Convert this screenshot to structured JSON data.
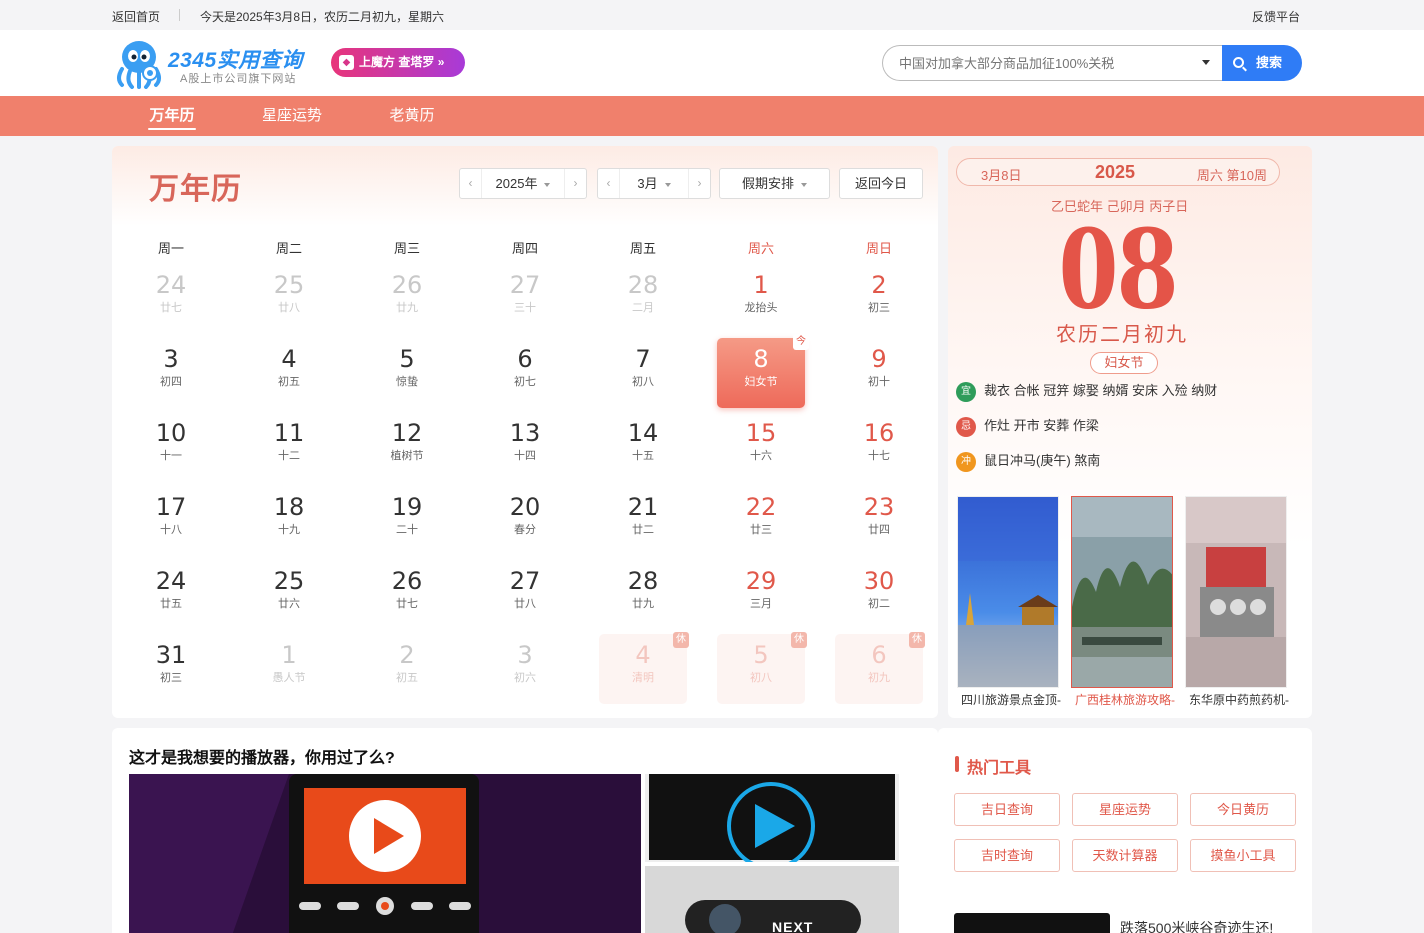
{
  "topbar": {
    "back_home": "返回首页",
    "today_text": "今天是2025年3月8日，农历二月初九，星期六",
    "feedback": "反馈平台"
  },
  "header": {
    "logo_text": "2345实用查询",
    "logo_sub": "A股上市公司旗下网站",
    "promo": "上魔方 查塔罗",
    "search_placeholder": "中国对加拿大部分商品加征100%关税",
    "search_button": "搜索"
  },
  "nav": [
    {
      "label": "万年历",
      "active": true
    },
    {
      "label": "星座运势",
      "active": false
    },
    {
      "label": "老黄历",
      "active": false
    }
  ],
  "calendar": {
    "title": "万年历",
    "year_select": "2025年",
    "month_select": "3月",
    "holiday_select": "假期安排",
    "back_today": "返回今日",
    "weekdays": [
      "周一",
      "周二",
      "周三",
      "周四",
      "周五",
      "周六",
      "周日"
    ],
    "today_badge": "今",
    "rest_badge": "休",
    "days": [
      {
        "d": "24",
        "l": "廿七",
        "s": "dim"
      },
      {
        "d": "25",
        "l": "廿八",
        "s": "dim"
      },
      {
        "d": "26",
        "l": "廿九",
        "s": "dim"
      },
      {
        "d": "27",
        "l": "三十",
        "s": "dim"
      },
      {
        "d": "28",
        "l": "二月",
        "s": "dim"
      },
      {
        "d": "1",
        "l": "龙抬头",
        "s": "we"
      },
      {
        "d": "2",
        "l": "初三",
        "s": "we"
      },
      {
        "d": "3",
        "l": "初四",
        "s": ""
      },
      {
        "d": "4",
        "l": "初五",
        "s": ""
      },
      {
        "d": "5",
        "l": "惊蛰",
        "s": ""
      },
      {
        "d": "6",
        "l": "初七",
        "s": ""
      },
      {
        "d": "7",
        "l": "初八",
        "s": ""
      },
      {
        "d": "8",
        "l": "妇女节",
        "s": "today"
      },
      {
        "d": "9",
        "l": "初十",
        "s": "we"
      },
      {
        "d": "10",
        "l": "十一",
        "s": ""
      },
      {
        "d": "11",
        "l": "十二",
        "s": ""
      },
      {
        "d": "12",
        "l": "植树节",
        "s": ""
      },
      {
        "d": "13",
        "l": "十四",
        "s": ""
      },
      {
        "d": "14",
        "l": "十五",
        "s": ""
      },
      {
        "d": "15",
        "l": "十六",
        "s": "we"
      },
      {
        "d": "16",
        "l": "十七",
        "s": "we"
      },
      {
        "d": "17",
        "l": "十八",
        "s": ""
      },
      {
        "d": "18",
        "l": "十九",
        "s": ""
      },
      {
        "d": "19",
        "l": "二十",
        "s": ""
      },
      {
        "d": "20",
        "l": "春分",
        "s": ""
      },
      {
        "d": "21",
        "l": "廿二",
        "s": ""
      },
      {
        "d": "22",
        "l": "廿三",
        "s": "we"
      },
      {
        "d": "23",
        "l": "廿四",
        "s": "we"
      },
      {
        "d": "24",
        "l": "廿五",
        "s": ""
      },
      {
        "d": "25",
        "l": "廿六",
        "s": ""
      },
      {
        "d": "26",
        "l": "廿七",
        "s": ""
      },
      {
        "d": "27",
        "l": "廿八",
        "s": ""
      },
      {
        "d": "28",
        "l": "廿九",
        "s": ""
      },
      {
        "d": "29",
        "l": "三月",
        "s": "we"
      },
      {
        "d": "30",
        "l": "初二",
        "s": "we"
      },
      {
        "d": "31",
        "l": "初三",
        "s": ""
      },
      {
        "d": "1",
        "l": "愚人节",
        "s": "dim"
      },
      {
        "d": "2",
        "l": "初五",
        "s": "dim"
      },
      {
        "d": "3",
        "l": "初六",
        "s": "dim"
      },
      {
        "d": "4",
        "l": "清明",
        "s": "dimred"
      },
      {
        "d": "5",
        "l": "初八",
        "s": "dimred"
      },
      {
        "d": "6",
        "l": "初九",
        "s": "dimred"
      }
    ]
  },
  "info": {
    "date_left": "3月8日",
    "year": "2025",
    "date_right": "周六 第10周",
    "ganzhi": "乙巳蛇年 己卯月 丙子日",
    "day": "08",
    "lunar": "农历二月初九",
    "festival": "妇女节",
    "yi_icon": "宜",
    "yi_text": "裁衣 合帐 冠笄 嫁娶 纳婿 安床 入殓 纳财",
    "ji_icon": "忌",
    "ji_text": "作灶 开市 安葬 作梁",
    "chong_icon": "冲",
    "chong_text": "鼠日冲马(庚午) 煞南",
    "thumbs": [
      {
        "caption": "四川旅游景点金顶-"
      },
      {
        "caption": "广西桂林旅游攻略-"
      },
      {
        "caption": "东华原中药煎药机-"
      }
    ]
  },
  "ad": {
    "title": "这才是我想要的播放器，你用过了么?",
    "next_label": "NEXT"
  },
  "hot": {
    "title": "热门工具",
    "tools": [
      "吉日查询",
      "星座运势",
      "今日黄历",
      "吉时查询",
      "天数计算器",
      "摸鱼小工具"
    ],
    "news_text": "跌落500米峡谷奇迹生还!"
  },
  "colors": {
    "accent": "#f0806c",
    "red": "#e0584a",
    "blue": "#2f7cf6",
    "yi": "#2e9c5a",
    "ji": "#e0584a",
    "chong": "#f0961e"
  }
}
